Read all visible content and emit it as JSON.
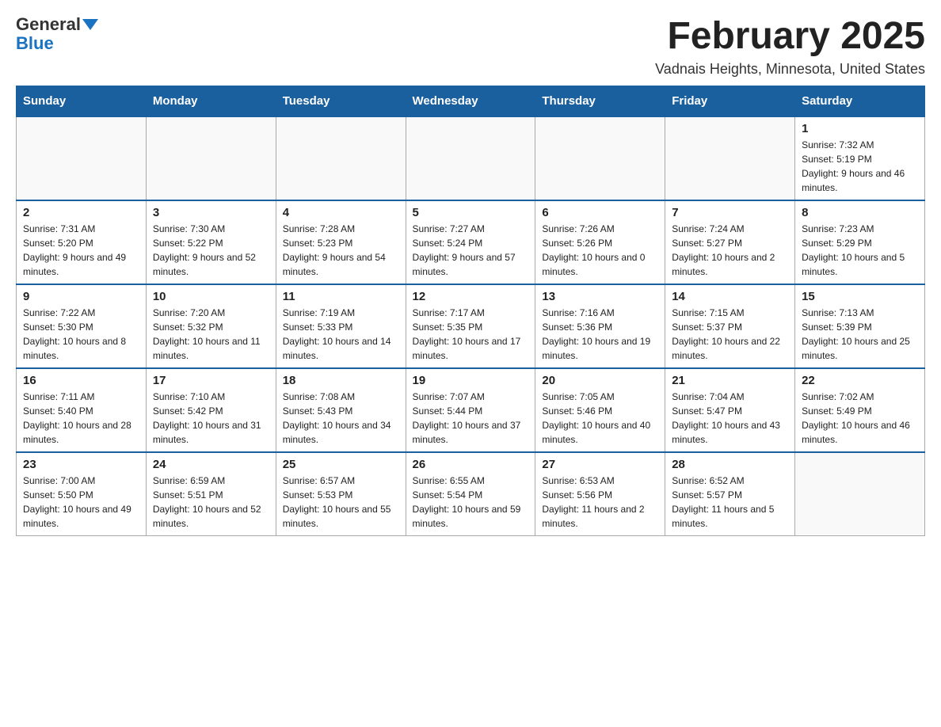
{
  "header": {
    "logo_text_general": "General",
    "logo_text_blue": "Blue",
    "month_title": "February 2025",
    "location": "Vadnais Heights, Minnesota, United States"
  },
  "weekdays": [
    "Sunday",
    "Monday",
    "Tuesday",
    "Wednesday",
    "Thursday",
    "Friday",
    "Saturday"
  ],
  "weeks": [
    [
      {
        "day": "",
        "info": ""
      },
      {
        "day": "",
        "info": ""
      },
      {
        "day": "",
        "info": ""
      },
      {
        "day": "",
        "info": ""
      },
      {
        "day": "",
        "info": ""
      },
      {
        "day": "",
        "info": ""
      },
      {
        "day": "1",
        "info": "Sunrise: 7:32 AM\nSunset: 5:19 PM\nDaylight: 9 hours and 46 minutes."
      }
    ],
    [
      {
        "day": "2",
        "info": "Sunrise: 7:31 AM\nSunset: 5:20 PM\nDaylight: 9 hours and 49 minutes."
      },
      {
        "day": "3",
        "info": "Sunrise: 7:30 AM\nSunset: 5:22 PM\nDaylight: 9 hours and 52 minutes."
      },
      {
        "day": "4",
        "info": "Sunrise: 7:28 AM\nSunset: 5:23 PM\nDaylight: 9 hours and 54 minutes."
      },
      {
        "day": "5",
        "info": "Sunrise: 7:27 AM\nSunset: 5:24 PM\nDaylight: 9 hours and 57 minutes."
      },
      {
        "day": "6",
        "info": "Sunrise: 7:26 AM\nSunset: 5:26 PM\nDaylight: 10 hours and 0 minutes."
      },
      {
        "day": "7",
        "info": "Sunrise: 7:24 AM\nSunset: 5:27 PM\nDaylight: 10 hours and 2 minutes."
      },
      {
        "day": "8",
        "info": "Sunrise: 7:23 AM\nSunset: 5:29 PM\nDaylight: 10 hours and 5 minutes."
      }
    ],
    [
      {
        "day": "9",
        "info": "Sunrise: 7:22 AM\nSunset: 5:30 PM\nDaylight: 10 hours and 8 minutes."
      },
      {
        "day": "10",
        "info": "Sunrise: 7:20 AM\nSunset: 5:32 PM\nDaylight: 10 hours and 11 minutes."
      },
      {
        "day": "11",
        "info": "Sunrise: 7:19 AM\nSunset: 5:33 PM\nDaylight: 10 hours and 14 minutes."
      },
      {
        "day": "12",
        "info": "Sunrise: 7:17 AM\nSunset: 5:35 PM\nDaylight: 10 hours and 17 minutes."
      },
      {
        "day": "13",
        "info": "Sunrise: 7:16 AM\nSunset: 5:36 PM\nDaylight: 10 hours and 19 minutes."
      },
      {
        "day": "14",
        "info": "Sunrise: 7:15 AM\nSunset: 5:37 PM\nDaylight: 10 hours and 22 minutes."
      },
      {
        "day": "15",
        "info": "Sunrise: 7:13 AM\nSunset: 5:39 PM\nDaylight: 10 hours and 25 minutes."
      }
    ],
    [
      {
        "day": "16",
        "info": "Sunrise: 7:11 AM\nSunset: 5:40 PM\nDaylight: 10 hours and 28 minutes."
      },
      {
        "day": "17",
        "info": "Sunrise: 7:10 AM\nSunset: 5:42 PM\nDaylight: 10 hours and 31 minutes."
      },
      {
        "day": "18",
        "info": "Sunrise: 7:08 AM\nSunset: 5:43 PM\nDaylight: 10 hours and 34 minutes."
      },
      {
        "day": "19",
        "info": "Sunrise: 7:07 AM\nSunset: 5:44 PM\nDaylight: 10 hours and 37 minutes."
      },
      {
        "day": "20",
        "info": "Sunrise: 7:05 AM\nSunset: 5:46 PM\nDaylight: 10 hours and 40 minutes."
      },
      {
        "day": "21",
        "info": "Sunrise: 7:04 AM\nSunset: 5:47 PM\nDaylight: 10 hours and 43 minutes."
      },
      {
        "day": "22",
        "info": "Sunrise: 7:02 AM\nSunset: 5:49 PM\nDaylight: 10 hours and 46 minutes."
      }
    ],
    [
      {
        "day": "23",
        "info": "Sunrise: 7:00 AM\nSunset: 5:50 PM\nDaylight: 10 hours and 49 minutes."
      },
      {
        "day": "24",
        "info": "Sunrise: 6:59 AM\nSunset: 5:51 PM\nDaylight: 10 hours and 52 minutes."
      },
      {
        "day": "25",
        "info": "Sunrise: 6:57 AM\nSunset: 5:53 PM\nDaylight: 10 hours and 55 minutes."
      },
      {
        "day": "26",
        "info": "Sunrise: 6:55 AM\nSunset: 5:54 PM\nDaylight: 10 hours and 59 minutes."
      },
      {
        "day": "27",
        "info": "Sunrise: 6:53 AM\nSunset: 5:56 PM\nDaylight: 11 hours and 2 minutes."
      },
      {
        "day": "28",
        "info": "Sunrise: 6:52 AM\nSunset: 5:57 PM\nDaylight: 11 hours and 5 minutes."
      },
      {
        "day": "",
        "info": ""
      }
    ]
  ]
}
